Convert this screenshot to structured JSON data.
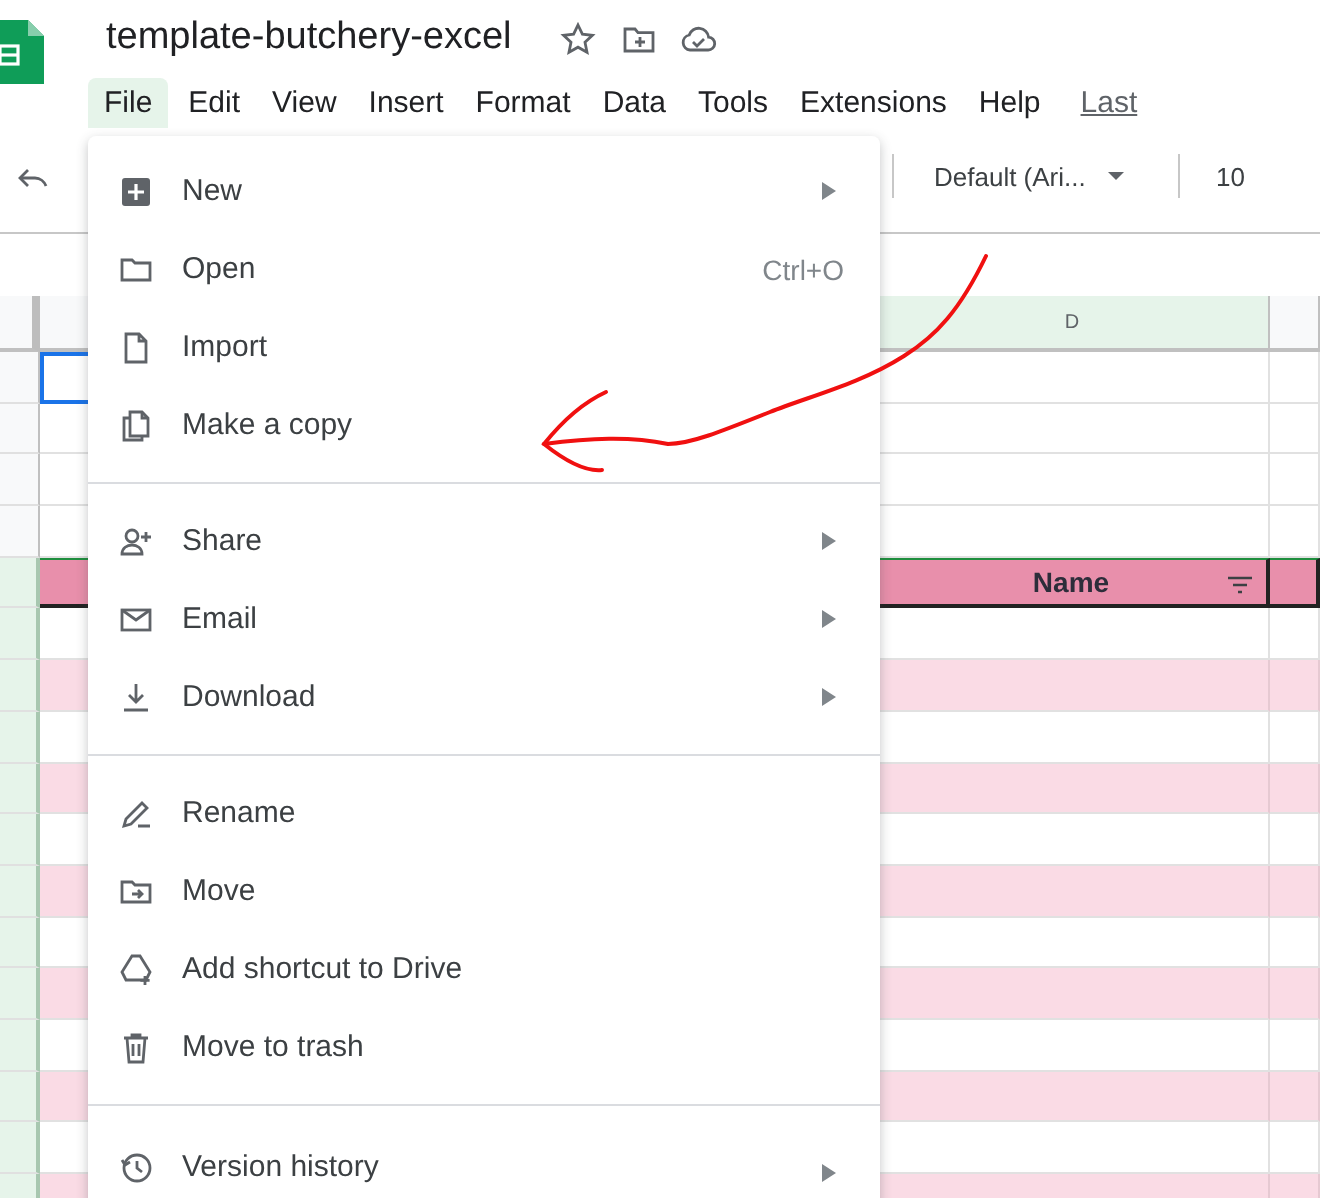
{
  "document": {
    "title": "template-butchery-excel"
  },
  "menubar": [
    {
      "label": "File",
      "selected": true
    },
    {
      "label": "Edit",
      "selected": false
    },
    {
      "label": "View",
      "selected": false
    },
    {
      "label": "Insert",
      "selected": false
    },
    {
      "label": "Format",
      "selected": false
    },
    {
      "label": "Data",
      "selected": false
    },
    {
      "label": "Tools",
      "selected": false
    },
    {
      "label": "Extensions",
      "selected": false
    },
    {
      "label": "Help",
      "selected": false
    }
  ],
  "last_edit_link": "Last",
  "toolbar": {
    "font": "Default (Ari...",
    "font_size": "10"
  },
  "sheet": {
    "column_header": "D",
    "rows": [
      {
        "kind": "blank",
        "selected": true
      },
      {
        "kind": "blank",
        "selected": false
      },
      {
        "kind": "blank",
        "selected": false
      },
      {
        "kind": "blank",
        "selected": false
      },
      {
        "kind": "header",
        "label": "Name"
      },
      {
        "kind": "band",
        "shaded": false
      },
      {
        "kind": "band",
        "shaded": true
      },
      {
        "kind": "band",
        "shaded": false
      },
      {
        "kind": "band",
        "shaded": true
      },
      {
        "kind": "band",
        "shaded": false
      },
      {
        "kind": "band",
        "shaded": true
      },
      {
        "kind": "band",
        "shaded": false
      },
      {
        "kind": "band",
        "shaded": true
      },
      {
        "kind": "band",
        "shaded": false
      },
      {
        "kind": "band",
        "shaded": true
      },
      {
        "kind": "band",
        "shaded": false
      },
      {
        "kind": "band",
        "shaded": true
      }
    ]
  },
  "file_menu": [
    {
      "kind": "item",
      "label": "New",
      "submenu": true
    },
    {
      "kind": "item",
      "label": "Open",
      "shortcut": "Ctrl+O"
    },
    {
      "kind": "item",
      "label": "Import"
    },
    {
      "kind": "item",
      "label": "Make a copy"
    },
    {
      "kind": "separator"
    },
    {
      "kind": "item",
      "label": "Share",
      "submenu": true
    },
    {
      "kind": "item",
      "label": "Email",
      "submenu": true
    },
    {
      "kind": "item",
      "label": "Download",
      "submenu": true
    },
    {
      "kind": "separator"
    },
    {
      "kind": "item",
      "label": "Rename"
    },
    {
      "kind": "item",
      "label": "Move"
    },
    {
      "kind": "item",
      "label": "Add shortcut to Drive"
    },
    {
      "kind": "item",
      "label": "Move to trash"
    },
    {
      "kind": "separator"
    },
    {
      "kind": "item",
      "label": "Version history",
      "submenu": true
    }
  ]
}
